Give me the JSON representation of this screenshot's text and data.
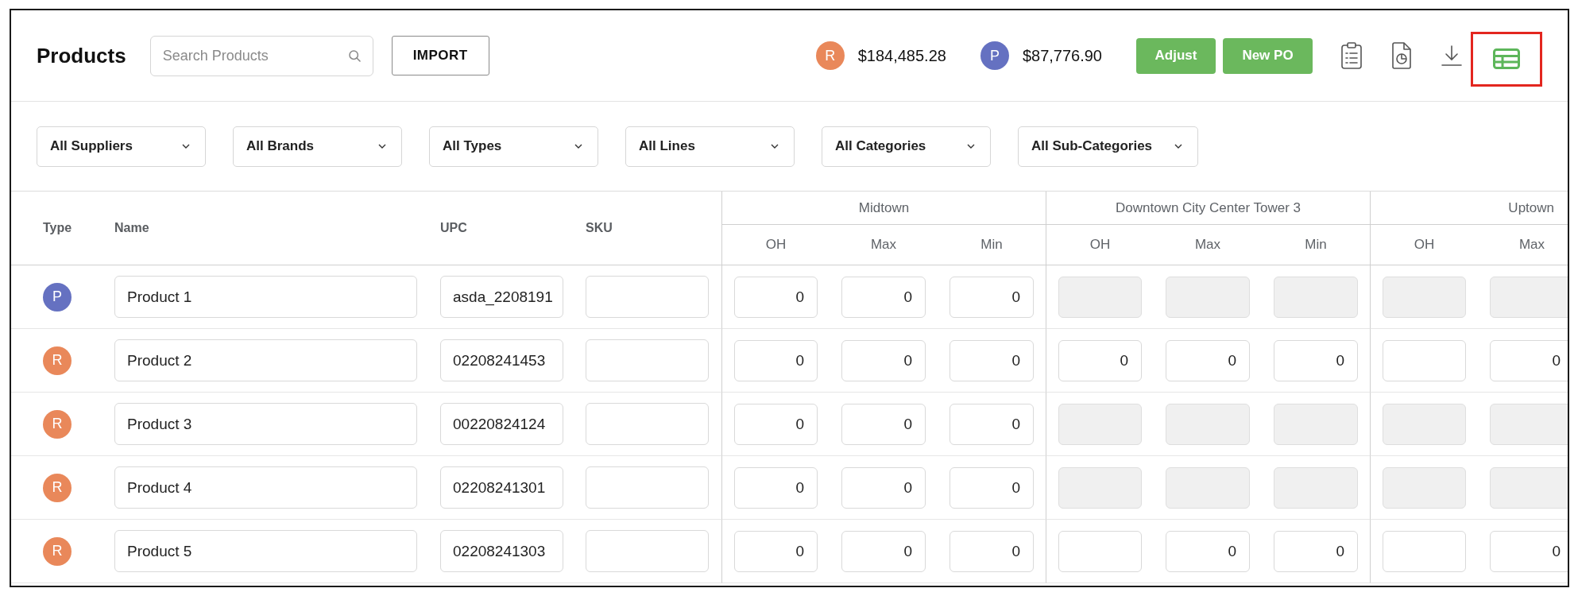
{
  "header": {
    "title": "Products",
    "search": {
      "placeholder": "Search Products"
    },
    "import_button": "IMPORT",
    "totals": [
      {
        "badge": "R",
        "color": "#e9885a",
        "amount": "$184,485.28"
      },
      {
        "badge": "P",
        "color": "#6571c1",
        "amount": "$87,776.90"
      }
    ],
    "buttons": [
      "Adjust",
      "New PO"
    ],
    "toolbar": [
      {
        "kind": "clipboard",
        "active": false,
        "highlighted": false
      },
      {
        "kind": "report",
        "active": false,
        "highlighted": false
      },
      {
        "kind": "download",
        "active": false,
        "highlighted": false
      },
      {
        "kind": "table",
        "active": true,
        "highlighted": true
      }
    ]
  },
  "filters": [
    "All Suppliers",
    "All Brands",
    "All Types",
    "All Lines",
    "All Categories",
    "All Sub-Categories"
  ],
  "table": {
    "columns": [
      "Type",
      "Name",
      "UPC",
      "SKU"
    ],
    "locations": [
      {
        "name": "Midtown",
        "columns": [
          "OH",
          "Max",
          "Min"
        ]
      },
      {
        "name": "Downtown City Center Tower 3",
        "columns": [
          "OH",
          "Max",
          "Min"
        ]
      },
      {
        "name": "Uptown",
        "columns": [
          "OH",
          "Max"
        ]
      }
    ],
    "rows": [
      {
        "type": "P",
        "color": "#6571c1",
        "name": "Product 1",
        "upc": "asda_2208191",
        "cells": [
          {
            "value": "0",
            "disabled": false
          },
          {
            "value": "0",
            "disabled": false
          },
          {
            "value": "0",
            "disabled": false
          },
          {
            "disabled": true
          },
          {
            "disabled": true
          },
          {
            "disabled": true
          },
          {
            "disabled": true
          },
          {
            "disabled": true
          }
        ]
      },
      {
        "type": "R",
        "color": "#e9885a",
        "name": "Product 2",
        "upc": "02208241453",
        "cells": [
          {
            "value": "0",
            "disabled": false
          },
          {
            "value": "0",
            "disabled": false
          },
          {
            "value": "0",
            "disabled": false
          },
          {
            "value": "0",
            "disabled": false
          },
          {
            "value": "0",
            "disabled": false
          },
          {
            "value": "0",
            "disabled": false
          },
          {
            "disabled": false
          },
          {
            "value": "0",
            "disabled": false
          }
        ]
      },
      {
        "type": "R",
        "color": "#e9885a",
        "name": "Product 3",
        "upc": "00220824124",
        "cells": [
          {
            "value": "0",
            "disabled": false
          },
          {
            "value": "0",
            "disabled": false
          },
          {
            "value": "0",
            "disabled": false
          },
          {
            "disabled": true
          },
          {
            "disabled": true
          },
          {
            "disabled": true
          },
          {
            "disabled": true
          },
          {
            "disabled": true
          }
        ]
      },
      {
        "type": "R",
        "color": "#e9885a",
        "name": "Product 4",
        "upc": "02208241301",
        "cells": [
          {
            "value": "0",
            "disabled": false
          },
          {
            "value": "0",
            "disabled": false
          },
          {
            "value": "0",
            "disabled": false
          },
          {
            "disabled": true
          },
          {
            "disabled": true
          },
          {
            "disabled": true
          },
          {
            "disabled": true
          },
          {
            "disabled": true
          }
        ]
      },
      {
        "type": "R",
        "color": "#e9885a",
        "name": "Product 5",
        "upc": "02208241303",
        "cells": [
          {
            "value": "0",
            "disabled": false
          },
          {
            "value": "0",
            "disabled": false
          },
          {
            "value": "0",
            "disabled": false
          },
          {
            "disabled": false
          },
          {
            "value": "0",
            "disabled": false
          },
          {
            "value": "0",
            "disabled": false
          },
          {
            "disabled": false
          },
          {
            "value": "0",
            "disabled": false
          }
        ]
      }
    ]
  }
}
